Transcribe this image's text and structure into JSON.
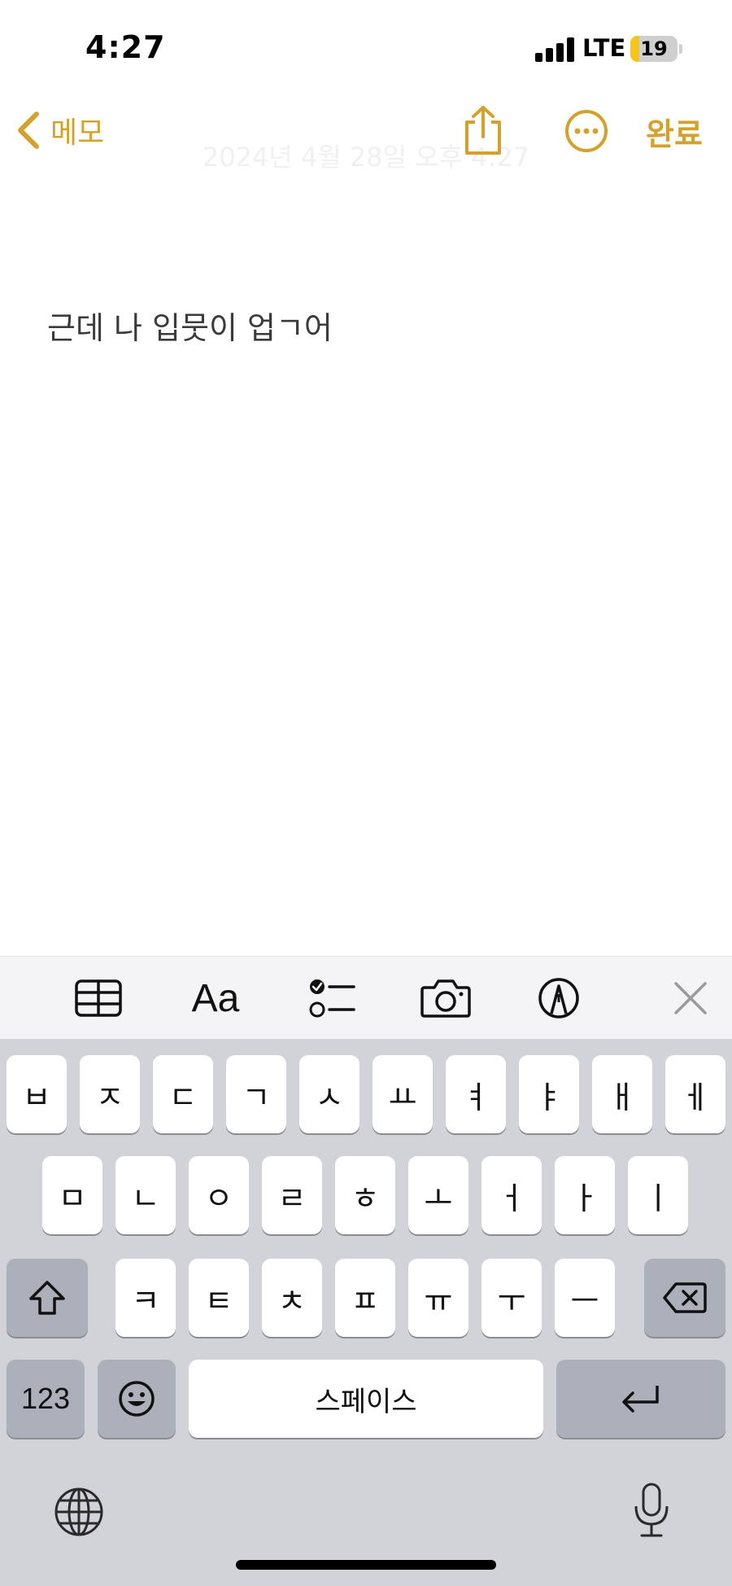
{
  "status_bar": {
    "time": "4:27",
    "network": "LTE",
    "battery_level": "19",
    "battery_color": "#f5c518"
  },
  "nav": {
    "back_label": "메모",
    "done_label": "완료",
    "date_header": "2024년 4월 28일 오후 4:27",
    "accent_color": "#d4a22c",
    "share_icon": "share-icon",
    "more_icon": "ellipsis-circle-icon"
  },
  "note": {
    "body_text": "근데 나 입뭇이 업ㄱ어"
  },
  "toolbar": {
    "items": [
      "table-icon",
      "Aa",
      "checklist-icon",
      "camera-icon",
      "markup-pen-icon",
      "close-icon"
    ]
  },
  "keyboard": {
    "row1": [
      "ㅂ",
      "ㅈ",
      "ㄷ",
      "ㄱ",
      "ㅅ",
      "ㅛ",
      "ㅕ",
      "ㅑ",
      "ㅐ",
      "ㅔ"
    ],
    "row2": [
      "ㅁ",
      "ㄴ",
      "ㅇ",
      "ㄹ",
      "ㅎ",
      "ㅗ",
      "ㅓ",
      "ㅏ",
      "ㅣ"
    ],
    "row3": [
      "ㅋ",
      "ㅌ",
      "ㅊ",
      "ㅍ",
      "ㅠ",
      "ㅜ",
      "ㅡ"
    ],
    "numbers_label": "123",
    "space_label": "스페이스",
    "shift_icon": "shift-icon",
    "delete_icon": "delete-icon",
    "emoji_icon": "emoji-icon",
    "return_icon": "return-icon",
    "globe_icon": "globe-icon",
    "mic_icon": "microphone-icon"
  }
}
